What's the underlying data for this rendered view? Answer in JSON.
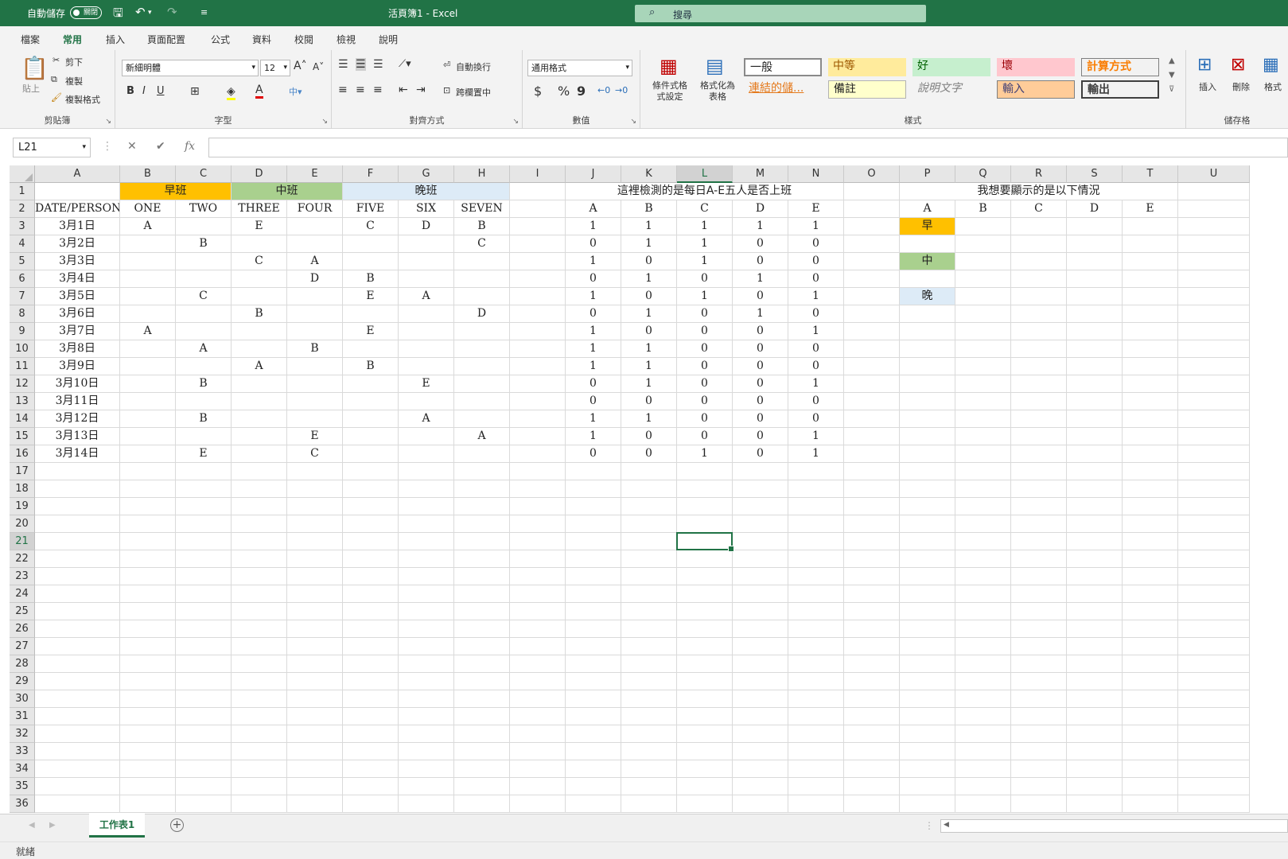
{
  "titlebar": {
    "autosave_label": "自動儲存",
    "autosave_state": "關閉",
    "title": "活頁簿1 - Excel",
    "search_placeholder": "搜尋"
  },
  "tabs": [
    "檔案",
    "常用",
    "插入",
    "頁面配置",
    "公式",
    "資料",
    "校閱",
    "檢視",
    "說明"
  ],
  "ribbon": {
    "clipboard": {
      "label": "剪貼簿",
      "paste": "貼上",
      "cut": "剪下",
      "copy": "複製",
      "format_painter": "複製格式"
    },
    "font": {
      "label": "字型",
      "name": "新細明體",
      "size": "12",
      "bold": "B",
      "italic": "I",
      "underline": "U"
    },
    "alignment": {
      "label": "對齊方式",
      "wrap": "自動換行",
      "merge": "跨欄置中"
    },
    "number": {
      "label": "數值",
      "format": "通用格式",
      "currency": "$",
      "percent": "%",
      "comma": "9"
    },
    "styles": {
      "label": "樣式",
      "conditional": "條件式格式設定",
      "table": "格式化為表格",
      "cells": [
        "一般",
        "中等",
        "好",
        "壞",
        "計算方式",
        "連結的儲...",
        "備註",
        "說明文字",
        "輸入",
        "輸出"
      ]
    },
    "cells_group": {
      "label": "儲存格",
      "insert": "插入",
      "delete": "刪除",
      "format": "格式"
    }
  },
  "formula_bar": {
    "name_box": "L21",
    "fx": "fx",
    "cancel": "✕",
    "enter": "✔",
    "value": ""
  },
  "columns": [
    "A",
    "B",
    "C",
    "D",
    "E",
    "F",
    "G",
    "H",
    "I",
    "J",
    "K",
    "L",
    "M",
    "N",
    "O",
    "P",
    "Q",
    "R",
    "S",
    "T",
    "U"
  ],
  "rows": [
    "1",
    "2",
    "3",
    "4",
    "5",
    "6",
    "7",
    "8",
    "9",
    "10",
    "11",
    "12",
    "13",
    "14",
    "15",
    "16",
    "17",
    "18",
    "19",
    "20",
    "21",
    "22",
    "23",
    "24",
    "25",
    "26",
    "27",
    "28",
    "29",
    "30",
    "31",
    "32",
    "33",
    "34",
    "35",
    "36"
  ],
  "selected": {
    "col": "L",
    "row": "21"
  },
  "sheet": {
    "shift_headers": [
      {
        "text": "早班",
        "color": "#ffc000"
      },
      {
        "text": "中班",
        "color": "#a9d08e"
      },
      {
        "text": "晚班",
        "color": "#ddebf7"
      }
    ],
    "check_title": "這裡檢測的是每日A-E五人是否上班",
    "want_title": "我想要顯示的是以下情況",
    "row2": [
      "DATE/PERSON",
      "ONE",
      "TWO",
      "THREE",
      "FOUR",
      "FIVE",
      "SIX",
      "SEVEN",
      "",
      "A",
      "B",
      "C",
      "D",
      "E",
      "",
      "A",
      "B",
      "C",
      "D",
      "E"
    ],
    "data": [
      [
        "3月1日",
        "A",
        "",
        "E",
        "",
        "C",
        "D",
        "B",
        "",
        "1",
        "1",
        "1",
        "1",
        "1"
      ],
      [
        "3月2日",
        "",
        "B",
        "",
        "",
        "",
        "",
        "C",
        "",
        "0",
        "1",
        "1",
        "0",
        "0"
      ],
      [
        "3月3日",
        "",
        "",
        "C",
        "A",
        "",
        "",
        "",
        "",
        "1",
        "0",
        "1",
        "0",
        "0"
      ],
      [
        "3月4日",
        "",
        "",
        "",
        "D",
        "B",
        "",
        "",
        "",
        "0",
        "1",
        "0",
        "1",
        "0"
      ],
      [
        "3月5日",
        "",
        "C",
        "",
        "",
        "E",
        "A",
        "",
        "",
        "1",
        "0",
        "1",
        "0",
        "1"
      ],
      [
        "3月6日",
        "",
        "",
        "B",
        "",
        "",
        "",
        "D",
        "",
        "0",
        "1",
        "0",
        "1",
        "0"
      ],
      [
        "3月7日",
        "A",
        "",
        "",
        "",
        "E",
        "",
        "",
        "",
        "1",
        "0",
        "0",
        "0",
        "1"
      ],
      [
        "3月8日",
        "",
        "A",
        "",
        "B",
        "",
        "",
        "",
        "",
        "1",
        "1",
        "0",
        "0",
        "0"
      ],
      [
        "3月9日",
        "",
        "",
        "A",
        "",
        "B",
        "",
        "",
        "",
        "1",
        "1",
        "0",
        "0",
        "0"
      ],
      [
        "3月10日",
        "",
        "B",
        "",
        "",
        "",
        "E",
        "",
        "",
        "0",
        "1",
        "0",
        "0",
        "1"
      ],
      [
        "3月11日",
        "",
        "",
        "",
        "",
        "",
        "",
        "",
        "",
        "0",
        "0",
        "0",
        "0",
        "0"
      ],
      [
        "3月12日",
        "",
        "B",
        "",
        "",
        "",
        "A",
        "",
        "",
        "1",
        "1",
        "0",
        "0",
        "0"
      ],
      [
        "3月13日",
        "",
        "",
        "",
        "E",
        "",
        "",
        "A",
        "",
        "1",
        "0",
        "0",
        "0",
        "1"
      ],
      [
        "3月14日",
        "",
        "E",
        "",
        "C",
        "",
        "",
        "",
        "",
        "0",
        "0",
        "1",
        "0",
        "1"
      ]
    ],
    "p_labels": [
      {
        "row": "3",
        "text": "早",
        "color": "#ffc000"
      },
      {
        "row": "5",
        "text": "中",
        "color": "#a9d08e"
      },
      {
        "row": "7",
        "text": "晚",
        "color": "#ddebf7"
      }
    ]
  },
  "sheet_tabs": [
    "工作表1"
  ],
  "status": "就緒"
}
